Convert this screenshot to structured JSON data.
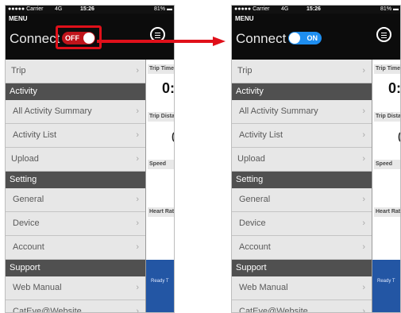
{
  "status_bar": {
    "carrier": "●●●●● Carrier",
    "network": "4G",
    "time": "15:26",
    "icons": "⊕ ↗ ✪ ✱",
    "battery": "81% ▬"
  },
  "header": {
    "menu_title": "MENU",
    "connect_label": "Connect"
  },
  "toggle_off_label": "OFF",
  "toggle_on_label": "ON",
  "menu": [
    {
      "type": "item",
      "label": "Trip"
    },
    {
      "type": "section",
      "label": "Activity"
    },
    {
      "type": "item",
      "label": "All Activity Summary"
    },
    {
      "type": "item",
      "label": "Activity List"
    },
    {
      "type": "item",
      "label": "Upload"
    },
    {
      "type": "section",
      "label": "Setting"
    },
    {
      "type": "item",
      "label": "General"
    },
    {
      "type": "item",
      "label": "Device"
    },
    {
      "type": "item",
      "label": "Account"
    },
    {
      "type": "section",
      "label": "Support"
    },
    {
      "type": "item",
      "label": "Web Manual"
    },
    {
      "type": "item",
      "label": "CatEye@Website"
    }
  ],
  "chevron": "›",
  "right_panel": {
    "labels": [
      "Trip Time",
      "Trip Distance",
      "Speed",
      "Heart Rate"
    ],
    "values": [
      "0:",
      "0"
    ],
    "ready_text": "Ready T"
  },
  "colors": {
    "accent_red": "#e0101a",
    "toggle_off": "#c0141b",
    "toggle_on": "#1e8ef0",
    "section_bg": "#505050"
  }
}
